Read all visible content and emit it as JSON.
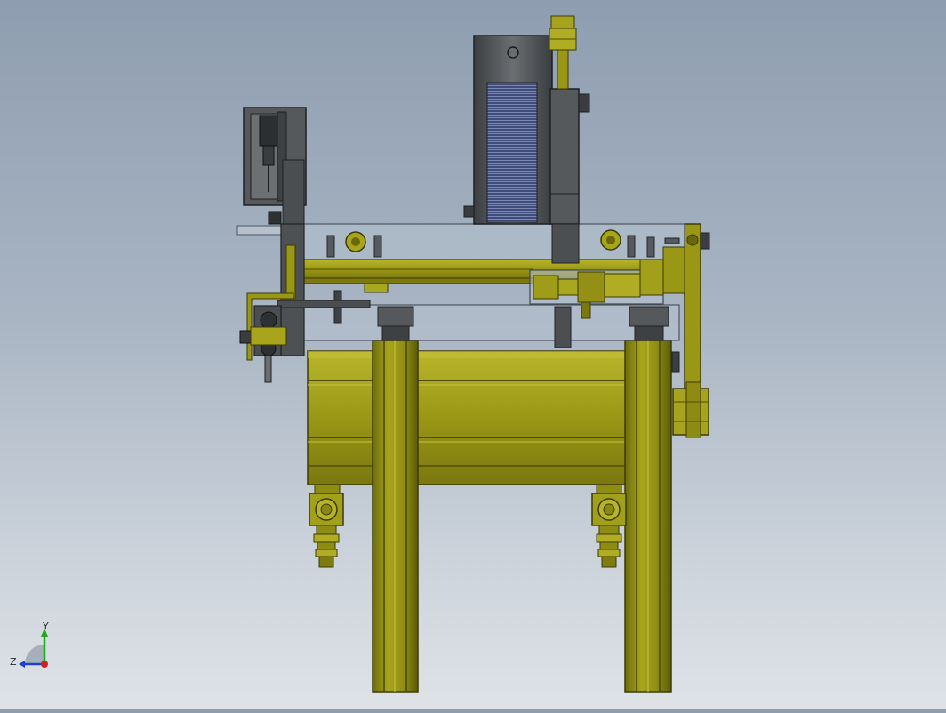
{
  "view": {
    "background_top": "#8e9db0",
    "background_bottom": "#dfe3e8"
  },
  "model": {
    "frame_color": "#9d9a16",
    "frame_dark": "#4f4d05",
    "frame_light": "#c5c23b",
    "steel_color": "#5f6366",
    "steel_dark": "#2e3133",
    "glass_color": "#b4c2cf",
    "coil_color": "#3f4c7a"
  },
  "triad": {
    "y_label": "Y",
    "z_label": "Z",
    "y_color": "#1ea81e",
    "z_color": "#2040d0",
    "x_color": "#d02020"
  }
}
